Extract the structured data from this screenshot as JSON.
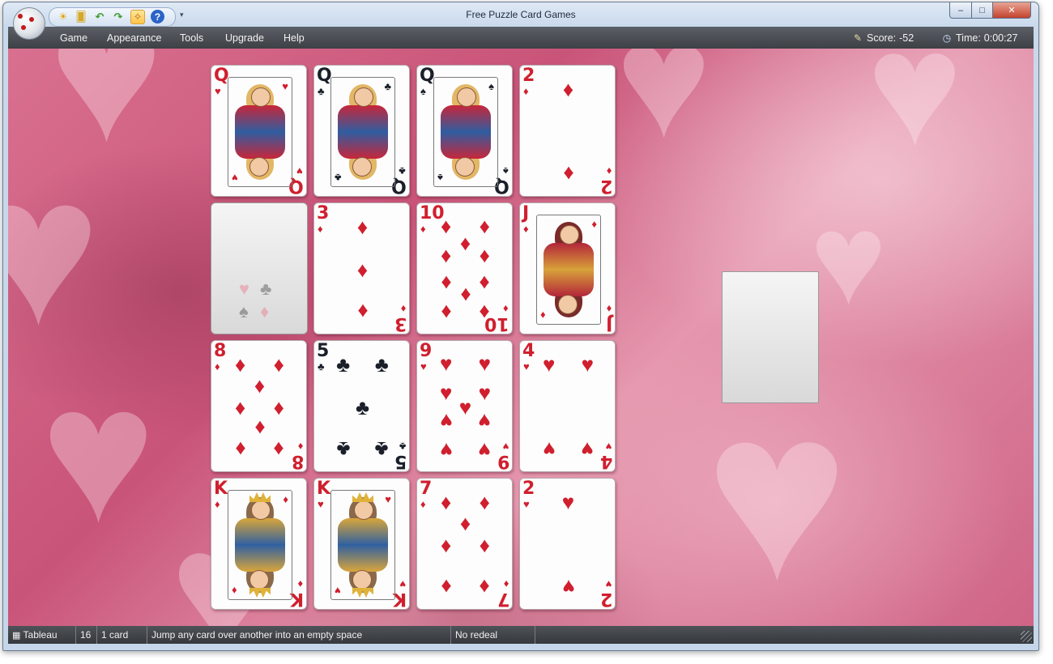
{
  "window": {
    "title": "Free Puzzle Card Games",
    "controls": {
      "minimize": "‒",
      "maximize": "□",
      "close": "✕"
    }
  },
  "quick_access": [
    {
      "name": "new-game-icon",
      "glyph": "☀"
    },
    {
      "name": "cards-icon",
      "glyph": "🂠"
    },
    {
      "name": "undo-icon",
      "glyph": "↶"
    },
    {
      "name": "redo-icon",
      "glyph": "↷"
    },
    {
      "name": "hint-icon",
      "glyph": "✧"
    },
    {
      "name": "help-icon",
      "glyph": "?"
    }
  ],
  "menu": {
    "items": [
      "Game",
      "Appearance",
      "Tools",
      "Upgrade",
      "Help"
    ]
  },
  "score": {
    "label": "Score:",
    "value": "-52"
  },
  "time": {
    "label": "Time:",
    "value": "0:00:27"
  },
  "tableau": [
    {
      "type": "face",
      "rank": "Q",
      "suit": "♥",
      "color": "red"
    },
    {
      "type": "face",
      "rank": "Q",
      "suit": "♣",
      "color": "black"
    },
    {
      "type": "face",
      "rank": "Q",
      "suit": "♠",
      "color": "black"
    },
    {
      "type": "pips",
      "rank": "2",
      "suit": "♦",
      "color": "red"
    },
    {
      "type": "empty"
    },
    {
      "type": "pips",
      "rank": "3",
      "suit": "♦",
      "color": "red"
    },
    {
      "type": "pips",
      "rank": "10",
      "suit": "♦",
      "color": "red"
    },
    {
      "type": "face",
      "rank": "J",
      "suit": "♦",
      "color": "red"
    },
    {
      "type": "pips",
      "rank": "8",
      "suit": "♦",
      "color": "red"
    },
    {
      "type": "pips",
      "rank": "5",
      "suit": "♣",
      "color": "black"
    },
    {
      "type": "pips",
      "rank": "9",
      "suit": "♥",
      "color": "red"
    },
    {
      "type": "pips",
      "rank": "4",
      "suit": "♥",
      "color": "red"
    },
    {
      "type": "face",
      "rank": "K",
      "suit": "♦",
      "color": "red"
    },
    {
      "type": "face",
      "rank": "K",
      "suit": "♥",
      "color": "red"
    },
    {
      "type": "pips",
      "rank": "7",
      "suit": "♦",
      "color": "red"
    },
    {
      "type": "pips",
      "rank": "2",
      "suit": "♥",
      "color": "red"
    }
  ],
  "empty_slot_suits": [
    "♥",
    "♣",
    "♠",
    "♦"
  ],
  "status": {
    "game_name": "Tableau",
    "count": "16",
    "cards": "1 card",
    "hint": "Jump any card over another into an empty space",
    "redeal": "No redeal"
  },
  "colors": {
    "card_red": "#d01f2e",
    "card_black": "#1a1f2a",
    "felt": "#c95479",
    "bar_dark": "#3d4045"
  }
}
